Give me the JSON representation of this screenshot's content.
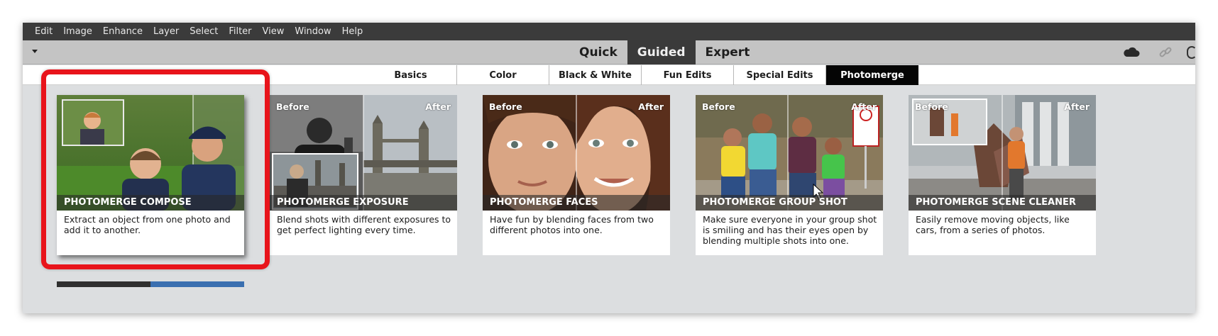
{
  "menu": [
    "Edit",
    "Image",
    "Enhance",
    "Layer",
    "Select",
    "Filter",
    "View",
    "Window",
    "Help"
  ],
  "modes": {
    "quick": "Quick",
    "guided": "Guided",
    "expert": "Expert",
    "active": "Guided"
  },
  "categories": {
    "items": [
      "Basics",
      "Color",
      "Black & White",
      "Fun Edits",
      "Special Edits",
      "Photomerge"
    ],
    "active": "Photomerge"
  },
  "icons": {
    "cloud": "cloud-icon",
    "link": "link-icon",
    "dropdown": "chevron-down-icon"
  },
  "cards": [
    {
      "title": "PHOTOMERGE COMPOSE",
      "description": "Extract an object from one photo and add it to another.",
      "before": "",
      "after": ""
    },
    {
      "title": "PHOTOMERGE EXPOSURE",
      "description": "Blend shots with different exposures to get perfect lighting every time.",
      "before": "Before",
      "after": "After"
    },
    {
      "title": "PHOTOMERGE FACES",
      "description": "Have fun by blending faces from two different photos into one.",
      "before": "Before",
      "after": "After"
    },
    {
      "title": "PHOTOMERGE GROUP SHOT",
      "description": "Make sure everyone in your group shot is smiling and has their eyes open by blending multiple shots into one.",
      "before": "Before",
      "after": "After"
    },
    {
      "title": "PHOTOMERGE SCENE CLEANER",
      "description": "Easily remove moving objects, like cars, from a series of photos.",
      "before": "Before",
      "after": "After"
    }
  ],
  "colors": {
    "highlight": "#e8141b",
    "active_tab": "#050505",
    "menu_bg": "#3b3b3b"
  }
}
